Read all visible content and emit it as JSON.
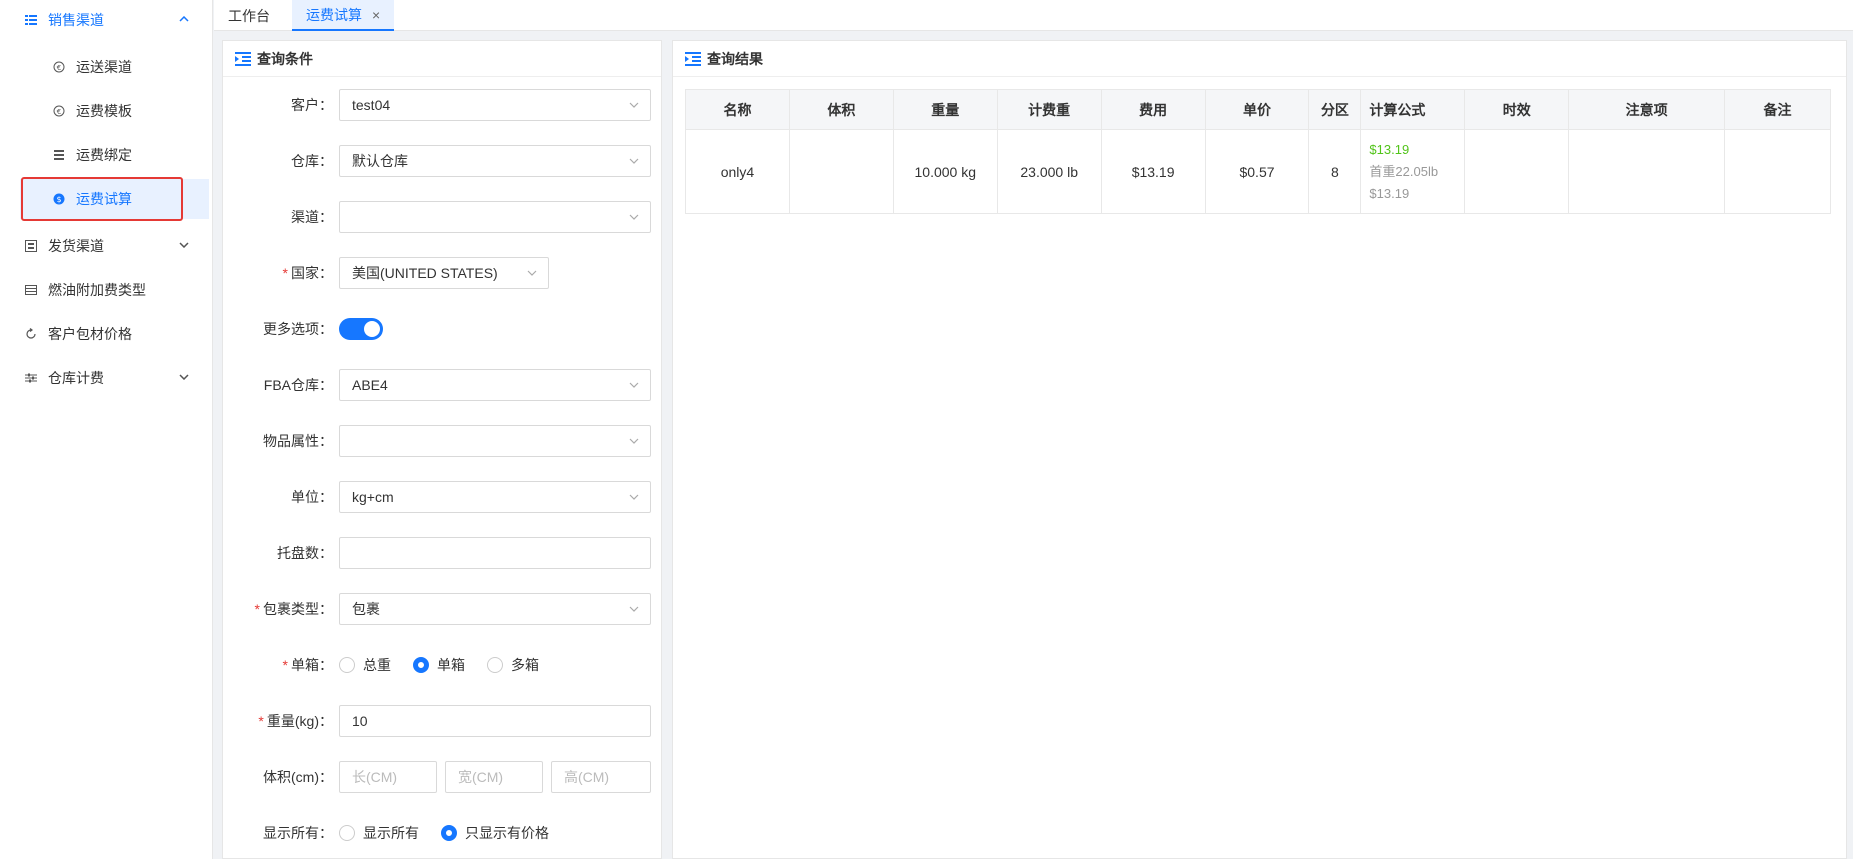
{
  "sidebar": {
    "groups": [
      {
        "label": "销售渠道",
        "icon": "list-icon"
      },
      {
        "label": "发货渠道",
        "icon": "grid-icon"
      },
      {
        "label": "燃油附加费类型",
        "icon": "table-icon"
      },
      {
        "label": "客户包材价格",
        "icon": "refresh-icon"
      },
      {
        "label": "仓库计费",
        "icon": "sliders-icon"
      }
    ],
    "sub_items": [
      {
        "label": "运送渠道",
        "icon": "e-circle-icon"
      },
      {
        "label": "运费模板",
        "icon": "e-circle-icon"
      },
      {
        "label": "运费绑定",
        "icon": "doc-icon"
      },
      {
        "label": "运费试算",
        "icon": "dollar-circle-icon"
      }
    ]
  },
  "tabs": [
    {
      "label": "工作台"
    },
    {
      "label": "运费试算",
      "close": "×"
    }
  ],
  "query_panel": {
    "title": "查询条件",
    "fields": {
      "customer": {
        "label": "客户：",
        "value": "test04"
      },
      "warehouse": {
        "label": "仓库：",
        "value": "默认仓库"
      },
      "channel": {
        "label": "渠道：",
        "value": ""
      },
      "country": {
        "label": "国家：",
        "value": "美国(UNITED STATES)"
      },
      "more_options": {
        "label": "更多选项："
      },
      "fba_warehouse": {
        "label": "FBA仓库：",
        "value": "ABE4"
      },
      "item_attr": {
        "label": "物品属性：",
        "value": ""
      },
      "unit": {
        "label": "单位：",
        "value": "kg+cm"
      },
      "pallets": {
        "label": "托盘数：",
        "value": ""
      },
      "package_type": {
        "label": "包裹类型：",
        "value": "包裹"
      },
      "box_mode": {
        "label": "单箱：",
        "options": [
          "总重",
          "单箱",
          "多箱"
        ],
        "selected": "单箱"
      },
      "weight": {
        "label": "重量(kg)：",
        "value": "10"
      },
      "volume": {
        "label": "体积(cm)：",
        "placeholders": [
          "长(CM)",
          "宽(CM)",
          "高(CM)"
        ]
      },
      "show_all": {
        "label": "显示所有：",
        "options": [
          "显示所有",
          "只显示有价格"
        ],
        "selected": "只显示有价格"
      }
    },
    "required_mark": "*"
  },
  "result_panel": {
    "title": "查询结果",
    "columns": [
      "名称",
      "体积",
      "重量",
      "计费重",
      "费用",
      "单价",
      "分区",
      "计算公式",
      "时效",
      "注意项",
      "备注"
    ],
    "rows": [
      {
        "name": "only4",
        "volume": "",
        "weight": "10.000 kg",
        "charge_weight": "23.000 lb",
        "fee": "$13.19",
        "unit_price": "$0.57",
        "zone": "8",
        "formula_total": "$13.19",
        "formula_first": "首重22.05lb",
        "formula_amount": "$13.19",
        "timeliness": "",
        "notes": "",
        "remark": ""
      }
    ]
  },
  "colors": {
    "accent": "#1677ff",
    "danger": "#e53935",
    "success": "#52c41a"
  }
}
